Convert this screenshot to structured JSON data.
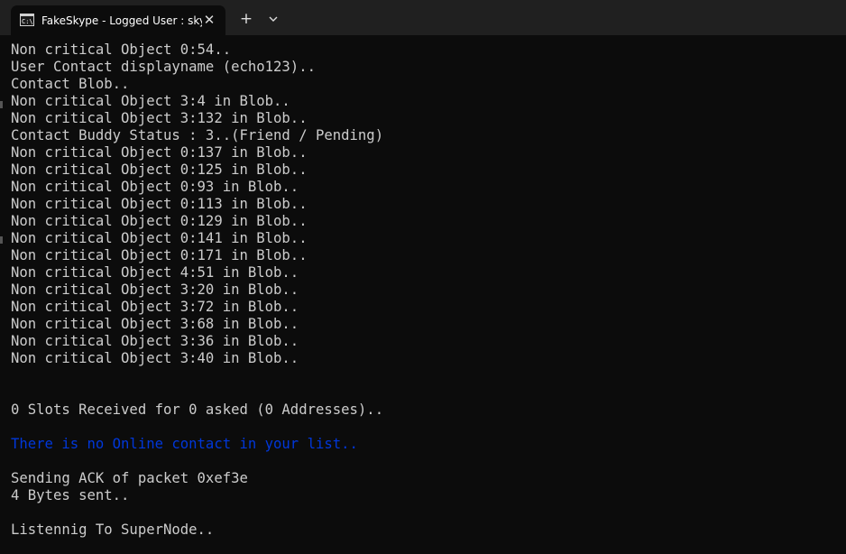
{
  "window": {
    "tab_title": "FakeSkype - Logged User : sky",
    "tab_icon": "terminal-icon",
    "close_icon": "close-icon",
    "new_tab_icon": "plus-icon",
    "dropdown_icon": "chevron-down-icon"
  },
  "colors": {
    "background": "#0c0c0c",
    "tabbar": "#202020",
    "text": "#cccccc",
    "highlight": "#0037da"
  },
  "console": {
    "lines": [
      {
        "text": "Non critical Object 0:54..",
        "color": "#cccccc"
      },
      {
        "text": "User Contact displayname (echo123)..",
        "color": "#cccccc"
      },
      {
        "text": "Contact Blob..",
        "color": "#cccccc"
      },
      {
        "text": "Non critical Object 3:4 in Blob..",
        "color": "#cccccc"
      },
      {
        "text": "Non critical Object 3:132 in Blob..",
        "color": "#cccccc"
      },
      {
        "text": "Contact Buddy Status : 3..(Friend / Pending)",
        "color": "#cccccc"
      },
      {
        "text": "Non critical Object 0:137 in Blob..",
        "color": "#cccccc"
      },
      {
        "text": "Non critical Object 0:125 in Blob..",
        "color": "#cccccc"
      },
      {
        "text": "Non critical Object 0:93 in Blob..",
        "color": "#cccccc"
      },
      {
        "text": "Non critical Object 0:113 in Blob..",
        "color": "#cccccc"
      },
      {
        "text": "Non critical Object 0:129 in Blob..",
        "color": "#cccccc"
      },
      {
        "text": "Non critical Object 0:141 in Blob..",
        "color": "#cccccc"
      },
      {
        "text": "Non critical Object 0:171 in Blob..",
        "color": "#cccccc"
      },
      {
        "text": "Non critical Object 4:51 in Blob..",
        "color": "#cccccc"
      },
      {
        "text": "Non critical Object 3:20 in Blob..",
        "color": "#cccccc"
      },
      {
        "text": "Non critical Object 3:72 in Blob..",
        "color": "#cccccc"
      },
      {
        "text": "Non critical Object 3:68 in Blob..",
        "color": "#cccccc"
      },
      {
        "text": "Non critical Object 3:36 in Blob..",
        "color": "#cccccc"
      },
      {
        "text": "Non critical Object 3:40 in Blob..",
        "color": "#cccccc"
      },
      {
        "text": "",
        "color": "#cccccc"
      },
      {
        "text": "",
        "color": "#cccccc"
      },
      {
        "text": "0 Slots Received for 0 asked (0 Addresses)..",
        "color": "#cccccc"
      },
      {
        "text": "",
        "color": "#cccccc"
      },
      {
        "text": "There is no Online contact in your list..",
        "color": "#0037da"
      },
      {
        "text": "",
        "color": "#cccccc"
      },
      {
        "text": "Sending ACK of packet 0xef3e",
        "color": "#cccccc"
      },
      {
        "text": "4 Bytes sent..",
        "color": "#cccccc"
      },
      {
        "text": "",
        "color": "#cccccc"
      },
      {
        "text": "Listennig To SuperNode..",
        "color": "#cccccc"
      }
    ]
  }
}
